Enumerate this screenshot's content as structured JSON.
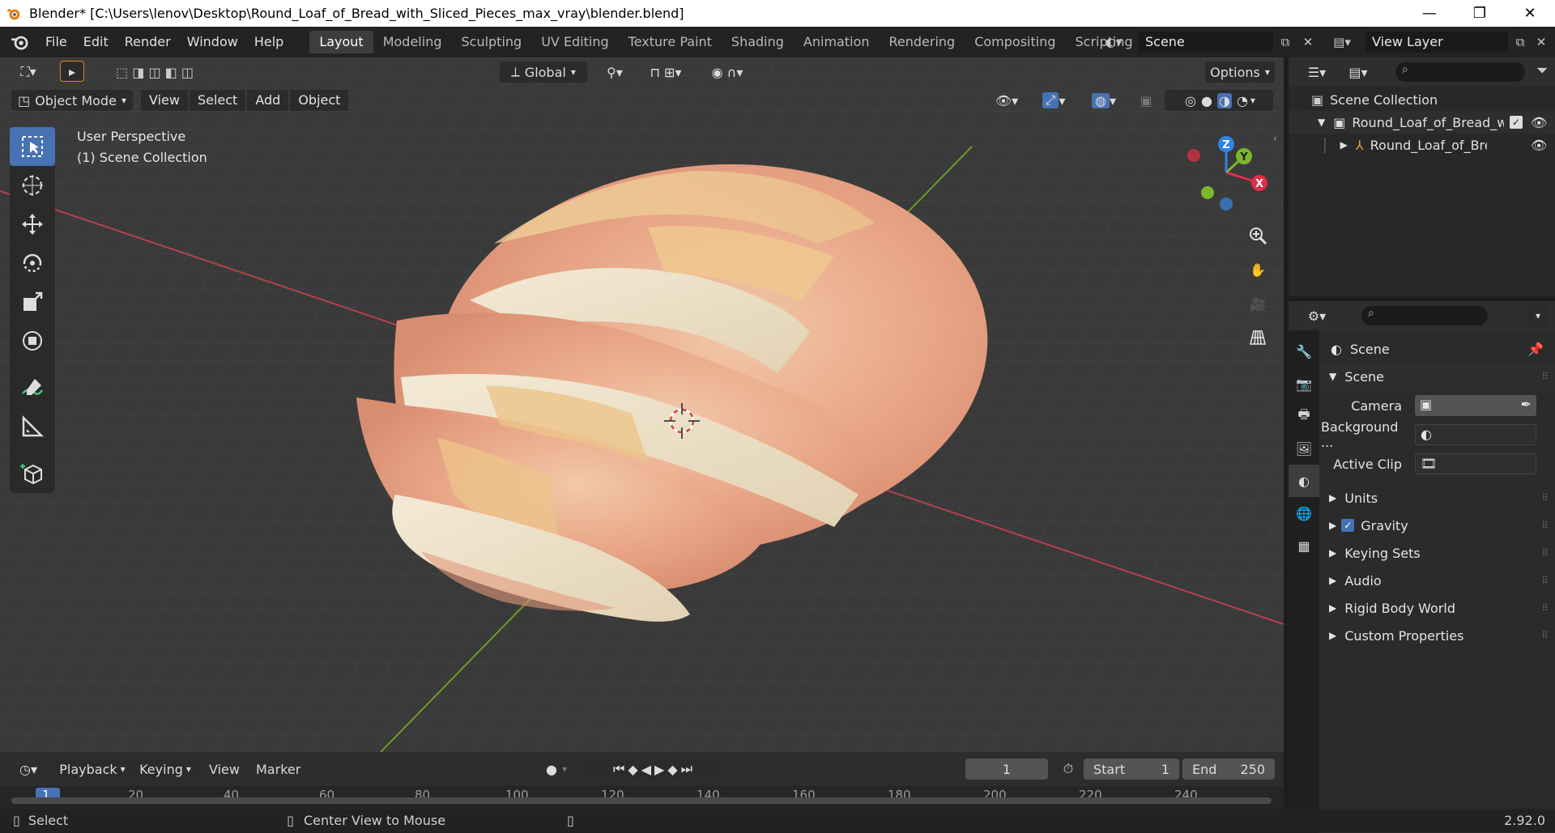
{
  "window": {
    "title": "Blender* [C:\\Users\\lenov\\Desktop\\Round_Loaf_of_Bread_with_Sliced_Pieces_max_vray\\blender.blend]",
    "minimize": "—",
    "maximize": "❐",
    "close": "✕"
  },
  "menu": [
    "File",
    "Edit",
    "Render",
    "Window",
    "Help"
  ],
  "workspaces": [
    "Layout",
    "Modeling",
    "Sculpting",
    "UV Editing",
    "Texture Paint",
    "Shading",
    "Animation",
    "Rendering",
    "Compositing",
    "Scripting"
  ],
  "active_workspace": "Layout",
  "scene": {
    "name": "Scene",
    "view_layer": "View Layer"
  },
  "viewport": {
    "transform_orientation": "Global",
    "options_label": "Options",
    "mode": "Object Mode",
    "menus": [
      "View",
      "Select",
      "Add",
      "Object"
    ],
    "perspective": "User Perspective",
    "collection": "(1) Scene Collection",
    "gizmo_axes": {
      "z": "Z",
      "y": "Y",
      "x": "X"
    }
  },
  "outliner": {
    "root": "Scene Collection",
    "collection": "Round_Loaf_of_Bread_wi",
    "object": "Round_Loaf_of_Breac"
  },
  "properties": {
    "context": "Scene",
    "panel_title": "Scene",
    "fields": [
      {
        "label": "Camera"
      },
      {
        "label": "Background ..."
      },
      {
        "label": "Active Clip"
      }
    ],
    "panels": [
      "Units",
      "Gravity",
      "Keying Sets",
      "Audio",
      "Rigid Body World",
      "Custom Properties"
    ]
  },
  "timeline": {
    "menus": [
      "Playback",
      "Keying",
      "View",
      "Marker"
    ],
    "current_frame": "1",
    "start_label": "Start",
    "start": "1",
    "end_label": "End",
    "end": "250",
    "ticks": [
      "1",
      "20",
      "40",
      "60",
      "80",
      "100",
      "120",
      "140",
      "160",
      "180",
      "200",
      "220",
      "240"
    ]
  },
  "status": {
    "select": "Select",
    "center": "Center View to Mouse",
    "version": "2.92.0"
  },
  "colors": {
    "accent": "#4772b3",
    "x_axis": "#e02d48",
    "y_axis": "#7ab82a",
    "z_axis": "#2f84e6",
    "bread_crust": "#e9a184",
    "bread_crumb": "#efe0c6"
  }
}
